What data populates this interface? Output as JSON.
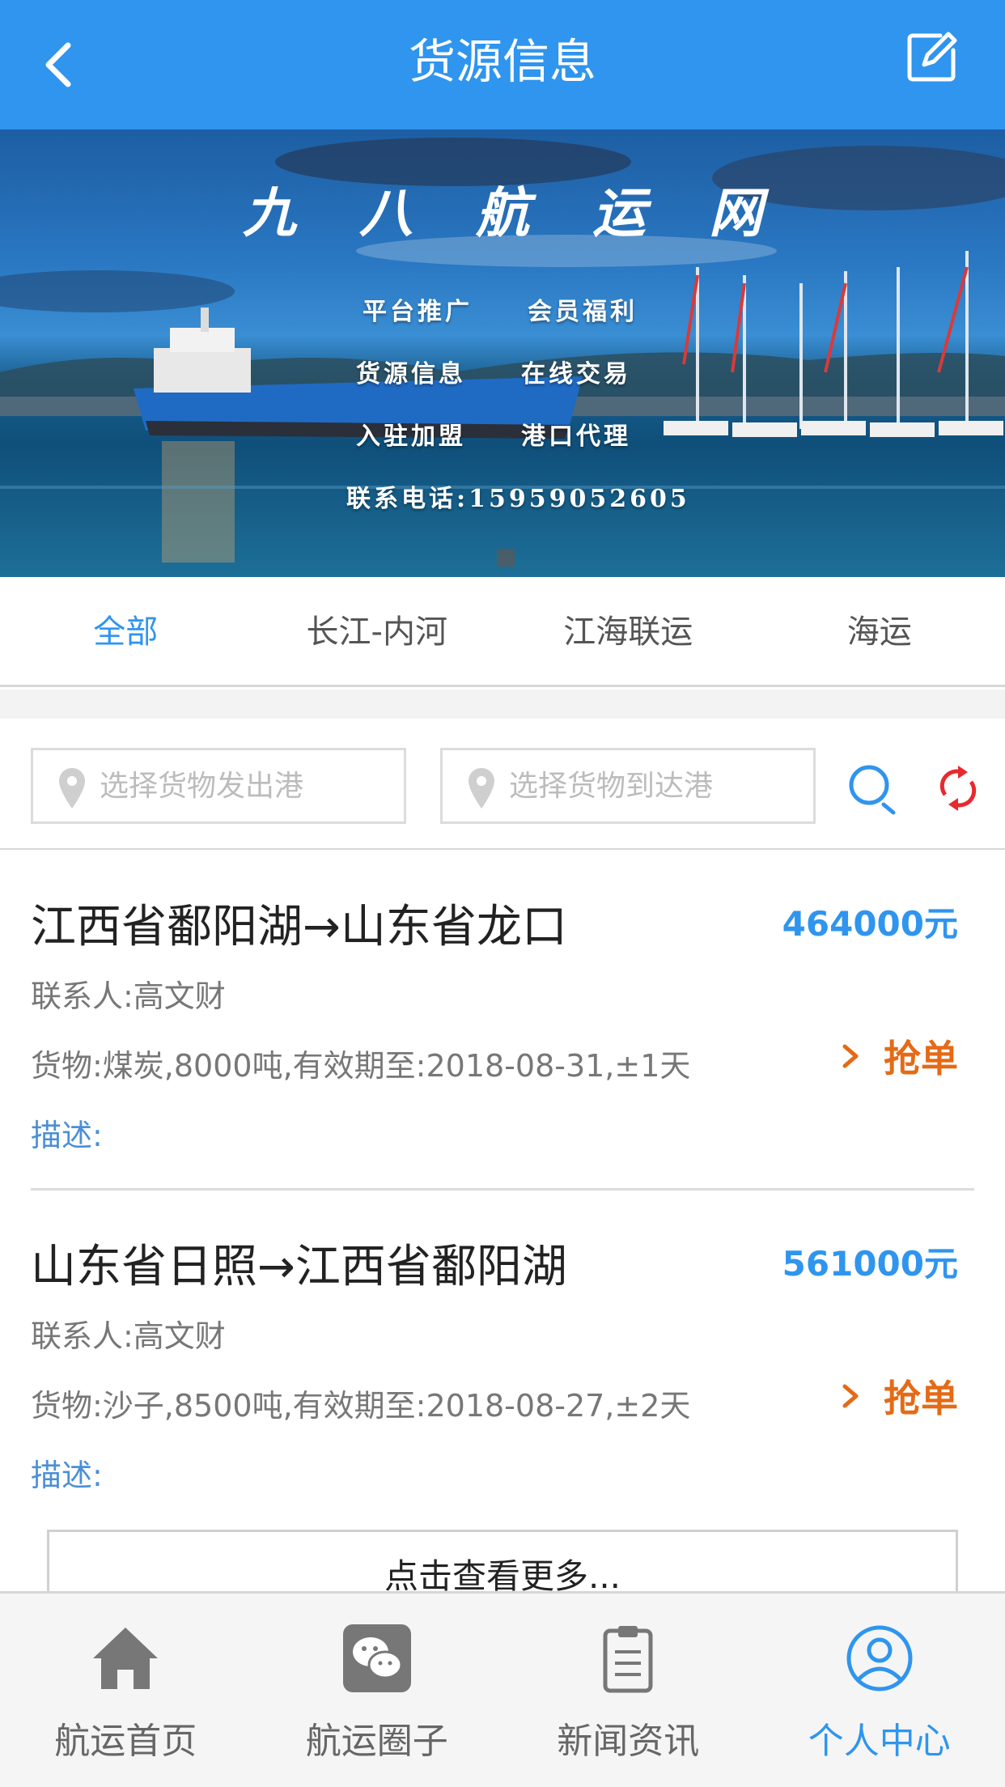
{
  "header": {
    "title": "货源信息",
    "back_icon": "chevron-left-icon",
    "edit_icon": "edit-icon"
  },
  "banner": {
    "brand": "九八航运网",
    "line1": "平台推广　　会员福利",
    "line2": "货源信息　　在线交易",
    "line3": "入驻加盟　　港口代理",
    "phone": "联系电话:15959052605"
  },
  "tabs": [
    {
      "label": "全部",
      "active": true
    },
    {
      "label": "长江-内河",
      "active": false
    },
    {
      "label": "江海联运",
      "active": false
    },
    {
      "label": "海运",
      "active": false
    }
  ],
  "search": {
    "from_placeholder": "选择货物发出港",
    "to_placeholder": "选择货物到达港",
    "search_icon": "search-icon",
    "refresh_icon": "refresh-icon"
  },
  "cargo": [
    {
      "route": "江西省鄱阳湖→山东省龙口",
      "price": "464000元",
      "contact": "联系人:高文财",
      "goods": "货物:煤炭,8000吨,有效期至:2018-08-31,±1天",
      "grab": "抢单",
      "desc": "描述:"
    },
    {
      "route": "山东省日照→江西省鄱阳湖",
      "price": "561000元",
      "contact": "联系人:高文财",
      "goods": "货物:沙子,8500吨,有效期至:2018-08-27,±2天",
      "grab": "抢单",
      "desc": "描述:"
    }
  ],
  "more_label": "点击查看更多...",
  "bottom_nav": [
    {
      "label": "航运首页",
      "icon": "home-icon",
      "active": false
    },
    {
      "label": "航运圈子",
      "icon": "wechat-icon",
      "active": false
    },
    {
      "label": "新闻资讯",
      "icon": "clipboard-icon",
      "active": false
    },
    {
      "label": "个人中心",
      "icon": "user-icon",
      "active": true
    }
  ],
  "colors": {
    "primary": "#2f95ee",
    "accent_orange": "#e56a16",
    "refresh_red": "#e8292f"
  }
}
